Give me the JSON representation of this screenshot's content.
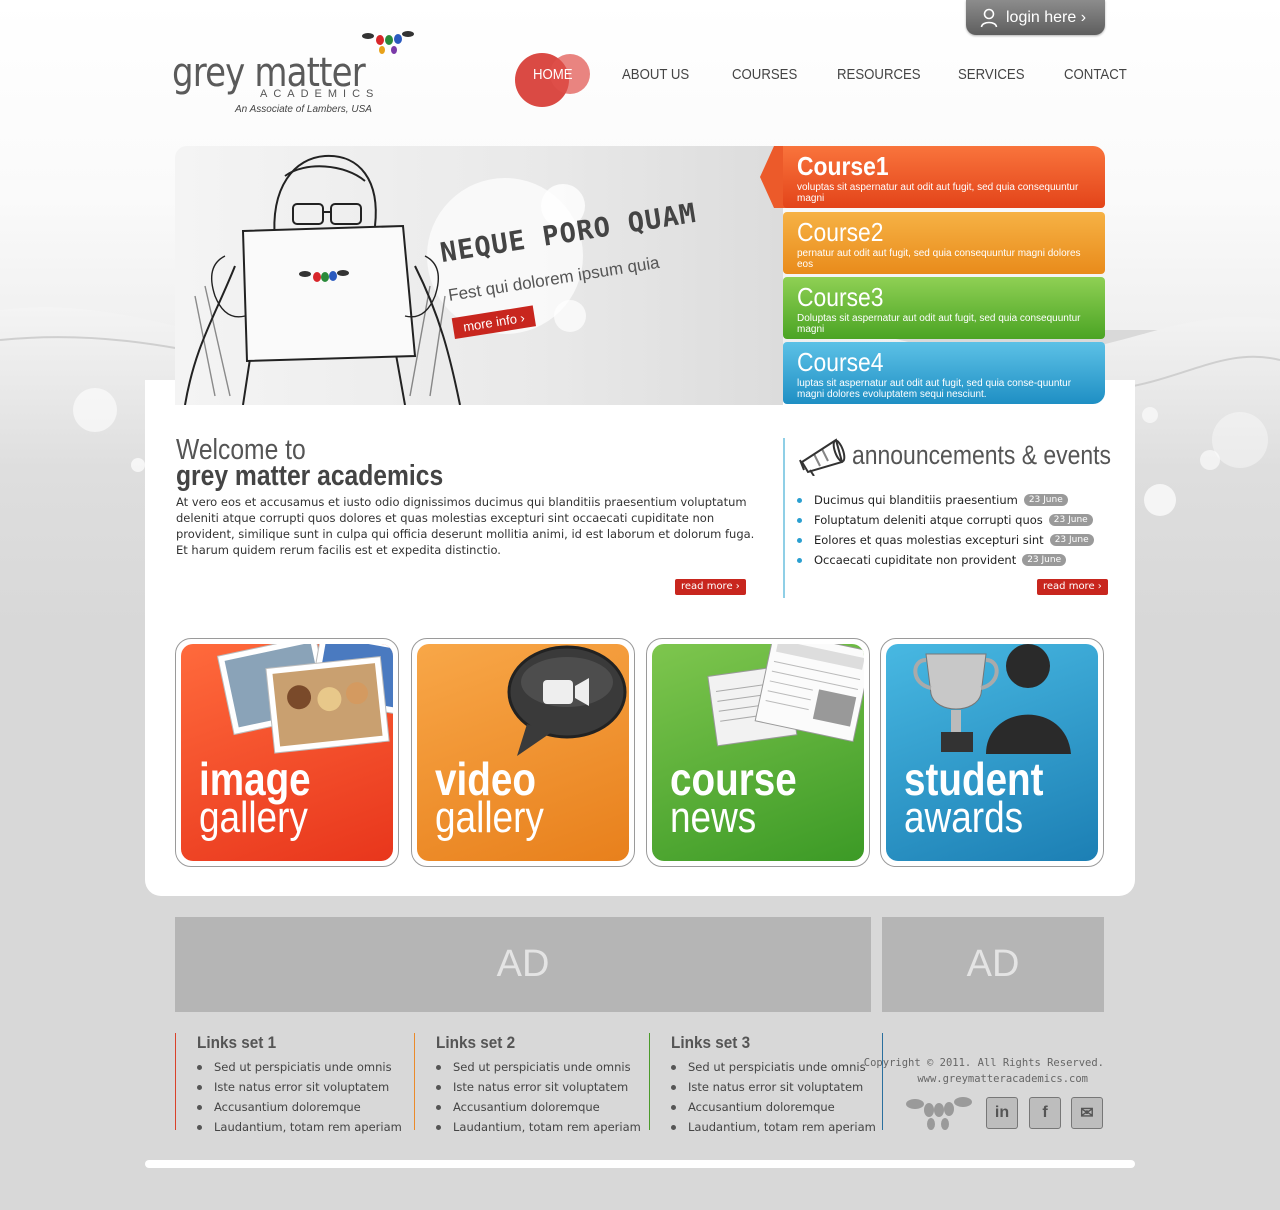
{
  "brand": {
    "name": "grey matter",
    "sub": "ACADEMICS",
    "tagline": "An Associate of Lambers, USA",
    "accent": "#c8261e"
  },
  "login": {
    "label": "login here ›",
    "icon": "user-icon"
  },
  "nav": {
    "items": [
      {
        "label": "HOME",
        "active": true
      },
      {
        "label": "ABOUT US"
      },
      {
        "label": "COURSES"
      },
      {
        "label": "RESOURCES"
      },
      {
        "label": "SERVICES"
      },
      {
        "label": "CONTACT"
      }
    ]
  },
  "banner": {
    "title": "NEQUE PORO QUAM",
    "subtitle": "Fest qui dolorem ipsum quia",
    "button": "more info ›"
  },
  "courses": [
    {
      "title": "Course1",
      "desc": "voluptas sit aspernatur aut odit aut fugit, sed quia consequuntur magni",
      "color": "#e94a1e"
    },
    {
      "title": "Course2",
      "desc": "pernatur aut odit aut fugit, sed quia consequuntur magni dolores eos",
      "color": "#ef9a26"
    },
    {
      "title": "Course3",
      "desc": "Doluptas sit aspernatur aut odit aut fugit, sed quia consequuntur magni",
      "color": "#5aae2c"
    },
    {
      "title": "Course4",
      "desc": "luptas sit aspernatur aut odit aut fugit, sed quia conse-quuntur magni dolores evoluptatem sequi nesciunt.",
      "color": "#269acc"
    }
  ],
  "welcome": {
    "line1": "Welcome to",
    "line2": "grey matter academics",
    "text": "At vero eos et accusamus et iusto odio dignissimos ducimus qui blanditiis praesentium voluptatum deleniti atque corrupti quos dolores et quas molestias excepturi sint occaecati cupiditate non provident, similique sunt in culpa qui officia deserunt mollitia animi, id est laborum et dolorum fuga. Et harum quidem rerum facilis est et expedita distinctio.",
    "read_more": "read more ›"
  },
  "announcements": {
    "title": "announcements & events",
    "icon": "megaphone-icon",
    "items": [
      {
        "text": "Ducimus qui blanditiis praesentium",
        "date": "23 June"
      },
      {
        "text": "Foluptatum deleniti atque corrupti quos",
        "date": "23 June"
      },
      {
        "text": "Eolores et quas molestias excepturi sint",
        "date": "23 June"
      },
      {
        "text": "Occaecati cupiditate non provident",
        "date": "23 June"
      }
    ],
    "read_more": "read more ›"
  },
  "tiles": [
    {
      "line1": "image",
      "line2": "gallery",
      "icon": "photos-icon"
    },
    {
      "line1": "video",
      "line2": "gallery",
      "icon": "video-camera-icon"
    },
    {
      "line1": "course",
      "line2": "news",
      "icon": "newspaper-icon"
    },
    {
      "line1": "student",
      "line2": "awards",
      "icon": "trophy-icon"
    }
  ],
  "ads": [
    "AD",
    "AD"
  ],
  "links": [
    {
      "title": "Links set 1",
      "color": "#d9412a",
      "items": [
        "Sed ut perspiciatis unde omnis",
        "Iste natus error sit voluptatem",
        "Accusantium doloremque",
        "Laudantium, totam rem aperiam"
      ]
    },
    {
      "title": "Links set 2",
      "color": "#ea8a2a",
      "items": [
        "Sed ut perspiciatis unde omnis",
        "Iste natus error sit voluptatem",
        "Accusantium doloremque",
        "Laudantium, totam rem aperiam"
      ]
    },
    {
      "title": "Links set 3",
      "color": "#4a9a2a",
      "items": [
        "Sed ut perspiciatis unde omnis",
        "Iste natus error sit voluptatem",
        "Accusantium doloremque",
        "Laudantium, totam rem aperiam"
      ]
    }
  ],
  "footer": {
    "copyright": "Copyright © 2011. All Rights Reserved.",
    "url": "www.greymatteracademics.com",
    "social": [
      {
        "icon": "linkedin-icon",
        "glyph": "in"
      },
      {
        "icon": "facebook-icon",
        "glyph": "f"
      },
      {
        "icon": "mail-icon",
        "glyph": "✉"
      }
    ]
  }
}
